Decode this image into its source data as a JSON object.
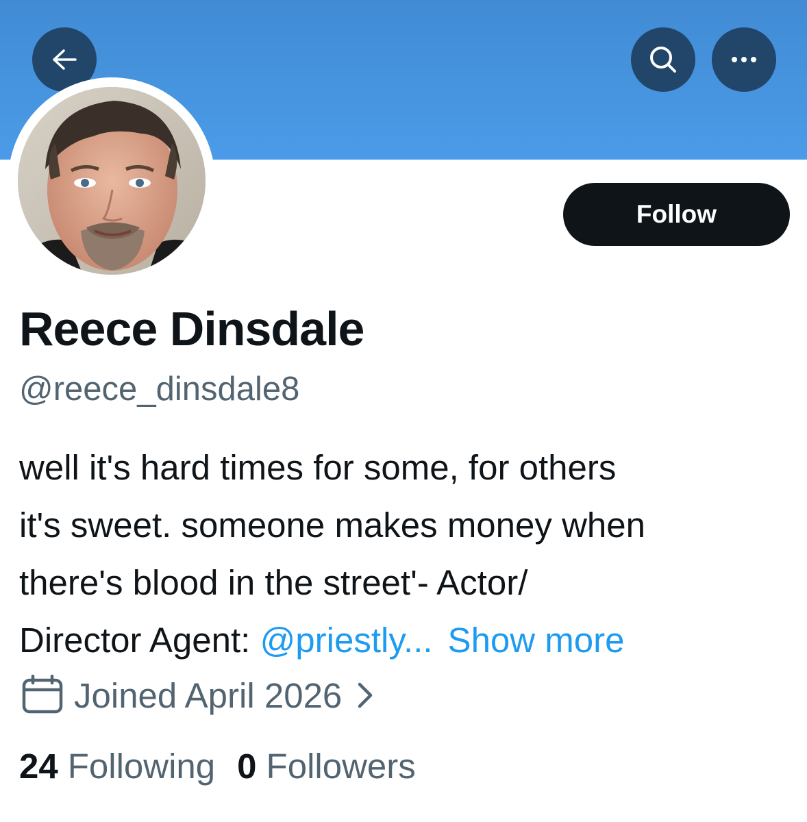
{
  "header": {
    "back_icon": "arrow-left-icon",
    "search_icon": "search-icon",
    "more_icon": "more-horizontal-icon",
    "banner_color": "#4a96e2"
  },
  "profile": {
    "follow_label": "Follow",
    "display_name": "Reece Dinsdale",
    "handle": "@reece_dinsdale8",
    "bio": {
      "line1": "well it's hard times for some, for others",
      "line2": "it's sweet. someone makes money when",
      "line3": "there's blood in the street'- Actor/",
      "line4_prefix": "Director Agent: ",
      "mention": "@priestly...",
      "show_more": "Show more"
    },
    "joined": "Joined April 2026",
    "stats": {
      "following_count": "24",
      "following_label": "Following",
      "followers_count": "0",
      "followers_label": "Followers"
    }
  },
  "colors": {
    "link": "#1d9bf0",
    "secondary_text": "#536471",
    "primary_text": "#0f1419",
    "header_button": "#22456a"
  }
}
